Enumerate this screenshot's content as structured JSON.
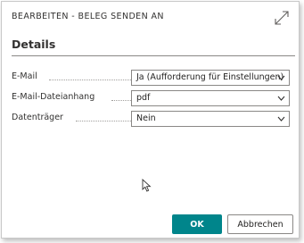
{
  "dialog": {
    "title": "BEARBEITEN - BELEG SENDEN AN",
    "expand_icon": "expand-diagonal-arrows-icon"
  },
  "section": {
    "title": "Details"
  },
  "fields": [
    {
      "label": "E-Mail",
      "value": "Ja (Aufforderung für Einstellungen)"
    },
    {
      "label": "E-Mail-Dateianhang",
      "value": "pdf"
    },
    {
      "label": "Datenträger",
      "value": "Nein"
    }
  ],
  "buttons": {
    "ok_label": "OK",
    "cancel_label": "Abbrechen"
  },
  "colors": {
    "accent": "#00858b"
  }
}
